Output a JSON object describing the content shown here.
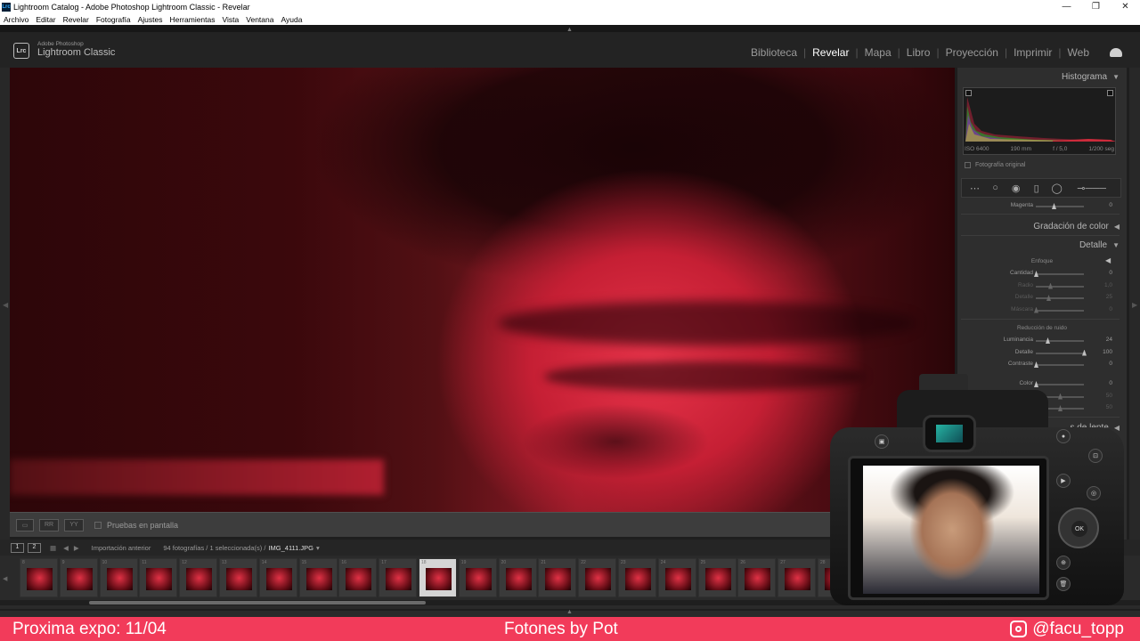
{
  "window": {
    "title": "Lightroom Catalog - Adobe Photoshop Lightroom Classic - Revelar",
    "app_icon": "Lrc",
    "controls": [
      "—",
      "❐",
      "✕"
    ]
  },
  "menu": [
    "Archivo",
    "Editar",
    "Revelar",
    "Fotografía",
    "Ajustes",
    "Herramientas",
    "Vista",
    "Ventana",
    "Ayuda"
  ],
  "identity": {
    "logo": "Lrc",
    "brand_small": "Adobe Photoshop",
    "brand_big": "Lightroom Classic"
  },
  "modules": [
    {
      "label": "Biblioteca",
      "active": false
    },
    {
      "label": "Revelar",
      "active": true
    },
    {
      "label": "Mapa",
      "active": false
    },
    {
      "label": "Libro",
      "active": false
    },
    {
      "label": "Proyección",
      "active": false
    },
    {
      "label": "Imprimir",
      "active": false
    },
    {
      "label": "Web",
      "active": false
    }
  ],
  "toolbar": {
    "softproof_label": "Pruebas en pantalla"
  },
  "panel": {
    "histogram_title": "Histograma",
    "histogram_info": [
      "ISO 6400",
      "190 mm",
      "f / 5,0",
      "1/200 seg"
    ],
    "original_photo": "Fotografía original",
    "magenta_label": "Magenta",
    "magenta_value": "0",
    "color_grading": "Gradación de color",
    "detail": "Detalle",
    "sharpening_title": "Enfoque",
    "sharpening": [
      {
        "label": "Cantidad",
        "value": "0",
        "pos": 0,
        "dim": false
      },
      {
        "label": "Radio",
        "value": "1,0",
        "pos": 0.3,
        "dim": true
      },
      {
        "label": "Detalle",
        "value": "25",
        "pos": 0.25,
        "dim": true
      },
      {
        "label": "Máscara",
        "value": "0",
        "pos": 0,
        "dim": true
      }
    ],
    "noise_title": "Reducción de ruido",
    "noise": [
      {
        "label": "Luminancia",
        "value": "24",
        "pos": 0.24,
        "dim": false
      },
      {
        "label": "Detalle",
        "value": "100",
        "pos": 1,
        "dim": false
      },
      {
        "label": "Contraste",
        "value": "0",
        "pos": 0,
        "dim": false
      }
    ],
    "color_noise": [
      {
        "label": "Color",
        "value": "0",
        "pos": 0,
        "dim": false
      },
      {
        "label": "Detalle",
        "value": "50",
        "pos": 0.5,
        "dim": true
      },
      {
        "label": "Suavizado",
        "value": "50",
        "pos": 0.5,
        "dim": true
      }
    ],
    "lens_partial": "s de lente"
  },
  "filmstrip": {
    "page1": "1",
    "page2": "2",
    "source": "Importación anterior",
    "info": "94 fotografías / 1 seleccionada(s) /",
    "filename": "IMG_4111.JPG",
    "indices": [
      "8",
      "9",
      "10",
      "11",
      "12",
      "13",
      "14",
      "15",
      "16",
      "17",
      "18",
      "19",
      "20",
      "21",
      "22",
      "23",
      "24",
      "25",
      "26",
      "27",
      "28"
    ],
    "selected_index": "18"
  },
  "banner": {
    "left": "Proxima expo: 11/04",
    "center": "Fotones by Pot",
    "right": "@facu_topp"
  },
  "camera_overlay": {
    "ok_label": "OK"
  },
  "colors": {
    "banner": "#f23b5a",
    "accent_red": "#e8344a"
  }
}
